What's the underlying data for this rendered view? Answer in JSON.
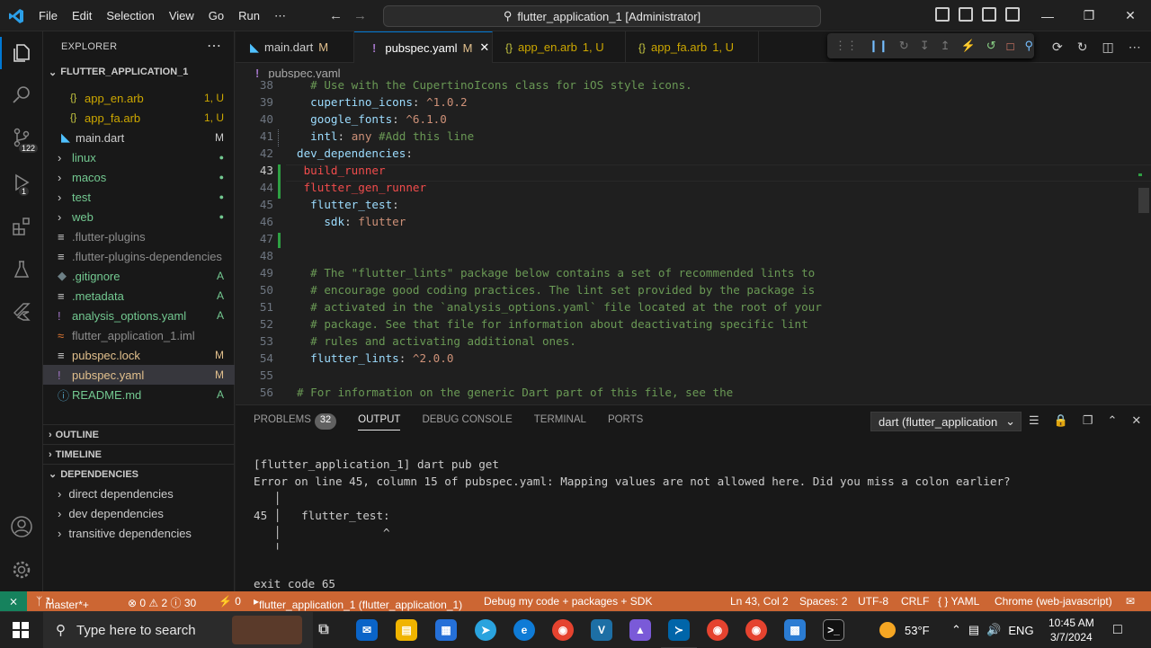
{
  "menu": {
    "file": "File",
    "edit": "Edit",
    "selection": "Selection",
    "view": "View",
    "go": "Go",
    "run": "Run",
    "more": "⋯"
  },
  "command_center": "flutter_application_1 [Administrator]",
  "explorer": {
    "title": "EXPLORER",
    "more": "⋯",
    "root": "FLUTTER_APPLICATION_1",
    "items": [
      {
        "icon": "{}",
        "label": "app_en.arb",
        "status": "1, U",
        "color": "#cca700"
      },
      {
        "icon": "{}",
        "label": "app_fa.arb",
        "status": "1, U",
        "color": "#cca700"
      },
      {
        "icon": "◣",
        "label": "main.dart",
        "status": "M",
        "color": "#cccccc"
      },
      {
        "icon": "›",
        "label": "linux",
        "status": "●",
        "color": "#73c991"
      },
      {
        "icon": "›",
        "label": "macos",
        "status": "●",
        "color": "#73c991"
      },
      {
        "icon": "›",
        "label": "test",
        "status": "●",
        "color": "#73c991"
      },
      {
        "icon": "›",
        "label": "web",
        "status": "●",
        "color": "#73c991"
      },
      {
        "icon": "≡",
        "label": ".flutter-plugins",
        "status": "",
        "color": "#8c8c8c"
      },
      {
        "icon": "≡",
        "label": ".flutter-plugins-dependencies",
        "status": "",
        "color": "#8c8c8c"
      },
      {
        "icon": "◆",
        "label": ".gitignore",
        "status": "A",
        "color": "#73c991"
      },
      {
        "icon": "≡",
        "label": ".metadata",
        "status": "A",
        "color": "#73c991"
      },
      {
        "icon": "!",
        "label": "analysis_options.yaml",
        "status": "A",
        "color": "#73c991"
      },
      {
        "icon": "≈",
        "label": "flutter_application_1.iml",
        "status": "",
        "color": "#8c8c8c"
      },
      {
        "icon": "≡",
        "label": "pubspec.lock",
        "status": "M",
        "color": "#e2c08d"
      },
      {
        "icon": "!",
        "label": "pubspec.yaml",
        "status": "M",
        "color": "#e2c08d"
      },
      {
        "icon": "ⓘ",
        "label": "README.md",
        "status": "A",
        "color": "#73c991"
      }
    ],
    "outline": "OUTLINE",
    "timeline": "TIMELINE",
    "dependencies": "DEPENDENCIES",
    "dep_items": [
      "direct dependencies",
      "dev dependencies",
      "transitive dependencies"
    ]
  },
  "activity": {
    "scm_badge": "122",
    "debug_badge": "1"
  },
  "tabs": [
    {
      "label": "main.dart",
      "status": "M",
      "color": "#e2c08d"
    },
    {
      "label": "pubspec.yaml",
      "status": "M",
      "color": "#e2c08d",
      "close": "✕"
    },
    {
      "label": "app_en.arb",
      "status": "1, U",
      "color": "#cca700"
    },
    {
      "label": "app_fa.arb",
      "status": "1, U",
      "color": "#cca700"
    }
  ],
  "breadcrumb": "pubspec.yaml",
  "code_lines": [
    {
      "n": "38",
      "t": "  # Use with the CupertinoIcons class for iOS style icons."
    },
    {
      "n": "39",
      "t": "  cupertino_icons: ^1.0.2"
    },
    {
      "n": "40",
      "t": "  google_fonts: ^6.1.0"
    },
    {
      "n": "41",
      "t": "  intl: any #Add this line"
    },
    {
      "n": "42",
      "t": "dev_dependencies:"
    },
    {
      "n": "43",
      "t": " build_runner"
    },
    {
      "n": "44",
      "t": " flutter_gen_runner"
    },
    {
      "n": "45",
      "t": "  flutter_test:"
    },
    {
      "n": "46",
      "t": "    sdk: flutter"
    },
    {
      "n": "47",
      "t": ""
    },
    {
      "n": "48",
      "t": ""
    },
    {
      "n": "49",
      "t": "  # The \"flutter_lints\" package below contains a set of recommended lints to"
    },
    {
      "n": "50",
      "t": "  # encourage good coding practices. The lint set provided by the package is"
    },
    {
      "n": "51",
      "t": "  # activated in the `analysis_options.yaml` file located at the root of your"
    },
    {
      "n": "52",
      "t": "  # package. See that file for information about deactivating specific lint"
    },
    {
      "n": "53",
      "t": "  # rules and activating additional ones."
    },
    {
      "n": "54",
      "t": "  flutter_lints: ^2.0.0"
    },
    {
      "n": "55",
      "t": ""
    },
    {
      "n": "56",
      "t": "# For information on the generic Dart part of this file, see the"
    }
  ],
  "panel": {
    "tabs": [
      "PROBLEMS",
      "OUTPUT",
      "DEBUG CONSOLE",
      "TERMINAL",
      "PORTS"
    ],
    "problems_count": "32",
    "channel": "dart (flutter_application",
    "output": [
      "[flutter_application_1] dart pub get",
      "Error on line 45, column 15 of pubspec.yaml: Mapping values are not allowed here. Did you miss a colon earlier?",
      "   │",
      "45 │   flutter_test:",
      "   │               ^",
      "   ╵",
      "",
      "exit code 65"
    ]
  },
  "status": {
    "branch": "master*+",
    "errors": "⊗ 0 ⚠ 2 ⓘ 30",
    "ports": "⚡ 0",
    "target": "flutter_application_1 (flutter_application_1)",
    "debug_mode": "Debug my code + packages + SDK",
    "position": "Ln 43, Col 2",
    "spaces": "Spaces: 2",
    "encoding": "UTF-8",
    "eol": "CRLF",
    "language": "{ } YAML",
    "device": "Chrome (web-javascript)"
  },
  "taskbar": {
    "search": "Type here to search",
    "weather": "53°F",
    "lang": "ENG",
    "time": "10:45 AM",
    "date": "3/7/2024"
  }
}
